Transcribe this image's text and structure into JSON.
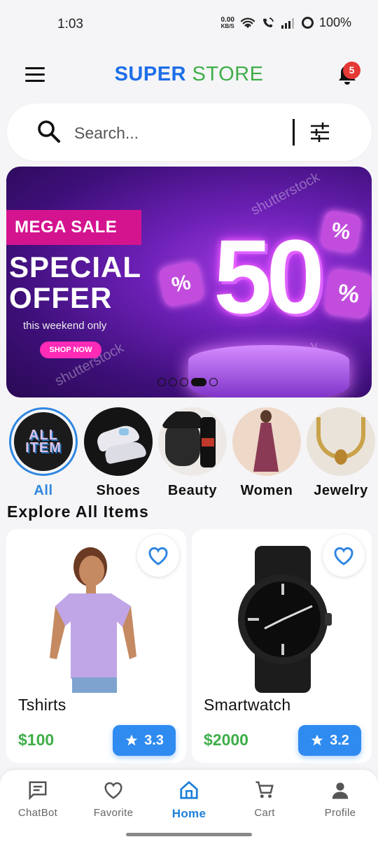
{
  "status_bar": {
    "time": "1:03",
    "net_speed_value": "0.00",
    "net_speed_unit": "KB/S",
    "battery": "100%"
  },
  "header": {
    "brand_part1": "SUPER",
    "brand_part2": "STORE",
    "notification_count": "5",
    "brand_colors": {
      "super": "#1e6ee8",
      "store": "#3fae49"
    }
  },
  "search": {
    "placeholder": "Search..."
  },
  "banner": {
    "tag": "MEGA SALE",
    "headline_line1": "SPECIAL",
    "headline_line2": "OFFER",
    "subline": "this weekend only",
    "cta": "SHOP NOW",
    "discount": "50",
    "watermark": "shutterstock",
    "slide_count": 5,
    "active_slide": 4
  },
  "categories": [
    {
      "label": "All",
      "active": true,
      "icon": "all-items-logo"
    },
    {
      "label": "Shoes",
      "active": false,
      "icon": "shoes-photo"
    },
    {
      "label": "Beauty",
      "active": false,
      "icon": "beauty-photo"
    },
    {
      "label": "Women",
      "active": false,
      "icon": "dress-photo"
    },
    {
      "label": "Jewelry",
      "active": false,
      "icon": "jewelry-photo"
    }
  ],
  "section": {
    "title": "Explore All Items"
  },
  "products": [
    {
      "name": "Tshirts",
      "price": "$100",
      "rating": "3.3"
    },
    {
      "name": "Smartwatch",
      "price": "$2000",
      "rating": "3.2"
    }
  ],
  "bottom_nav": [
    {
      "label": "ChatBot",
      "icon": "chat-icon",
      "active": false
    },
    {
      "label": "Favorite",
      "icon": "heart-icon",
      "active": false
    },
    {
      "label": "Home",
      "icon": "home-icon",
      "active": true
    },
    {
      "label": "Cart",
      "icon": "cart-icon",
      "active": false
    },
    {
      "label": "Profile",
      "icon": "person-icon",
      "active": false
    }
  ],
  "colors": {
    "accent_blue": "#2f86e0",
    "price_green": "#3fae49",
    "badge_red": "#e53935"
  }
}
